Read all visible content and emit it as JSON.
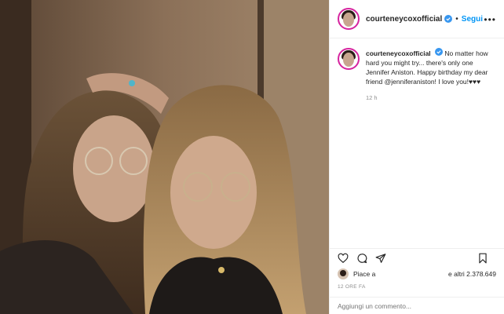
{
  "header": {
    "username": "courteneycoxofficial",
    "separator": "•",
    "follow_label": "Segui",
    "more_label": "•••"
  },
  "caption": {
    "username": "courteneycoxofficial",
    "text": "No matter how hard you might try... there's only one Jennifer Aniston. Happy birthday my dear friend @jenniferaniston! I love you!♥♥♥",
    "time": "12 h"
  },
  "likes": {
    "prefix": "Piace a",
    "suffix": "e altri 2.378.649"
  },
  "posted_ago": "12 ORE FA",
  "comment": {
    "placeholder": "Aggiungi un commento..."
  },
  "colors": {
    "accent": "#0095f6",
    "verified": "#3897f0",
    "ring": "#d6249f"
  },
  "icons": {
    "like": "heart-icon",
    "comment": "comment-icon",
    "share": "share-icon",
    "save": "bookmark-icon",
    "verified": "verified-badge-icon"
  }
}
